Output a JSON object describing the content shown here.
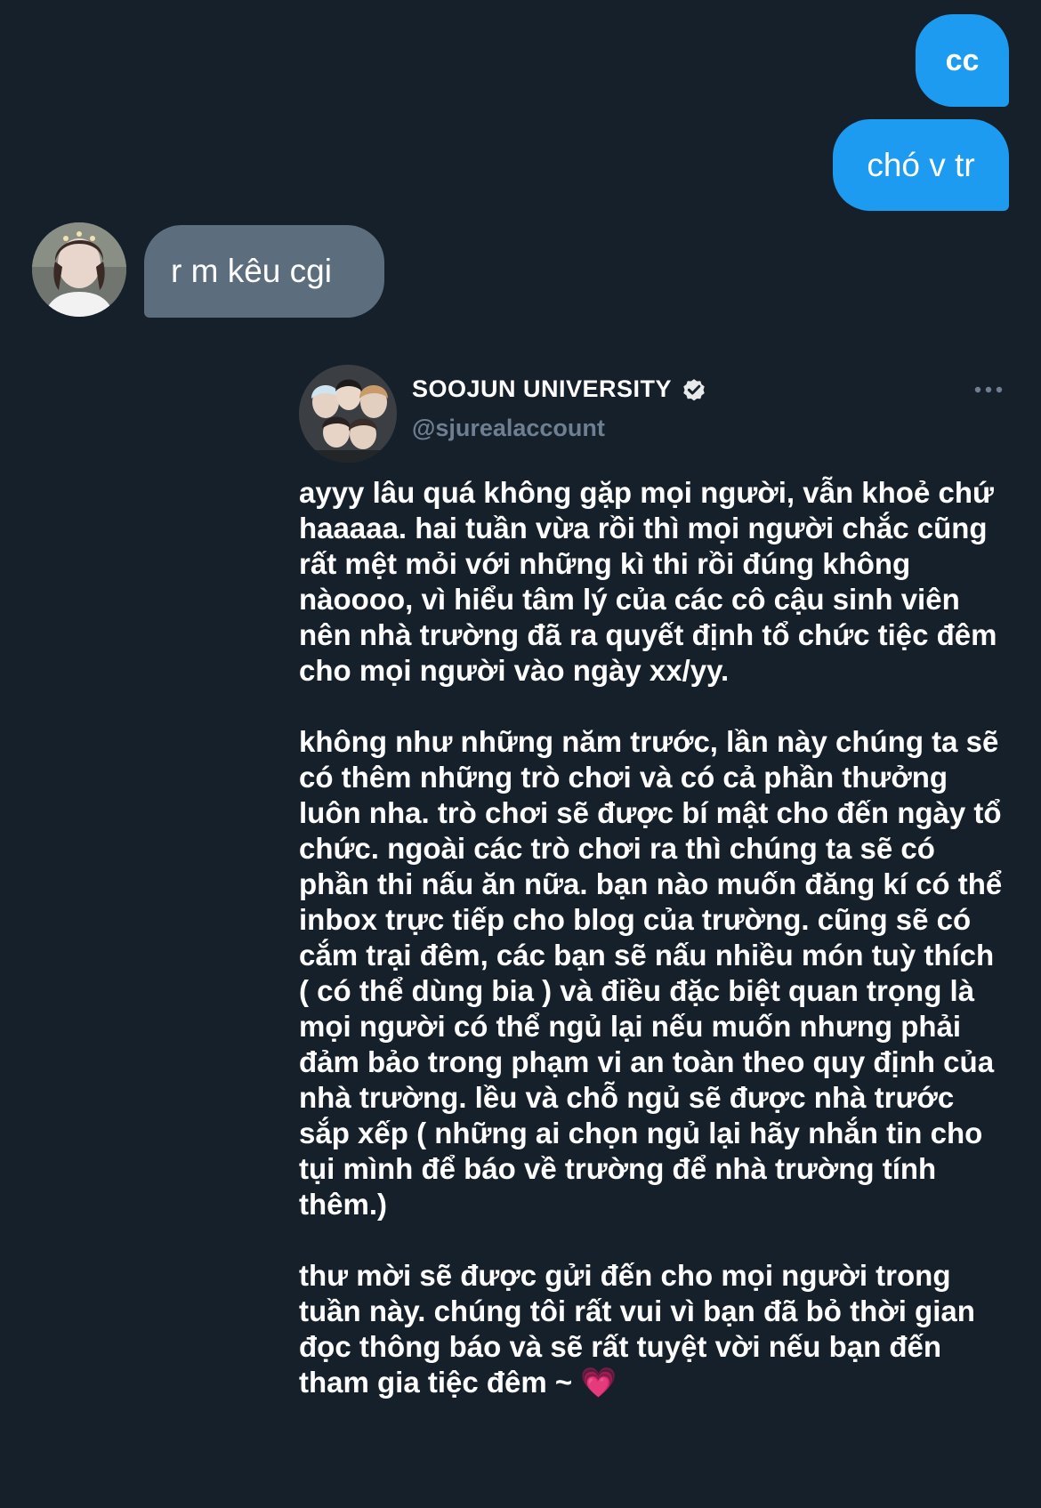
{
  "messages": [
    {
      "id": "cc",
      "direction": "outgoing",
      "text": "cc"
    },
    {
      "id": "chovtr",
      "direction": "outgoing",
      "text": "chó v tr"
    },
    {
      "id": "rm",
      "direction": "incoming",
      "text": "r m kêu cgi"
    }
  ],
  "tweet": {
    "name": "SOOJUN UNIVERSITY",
    "handle": "@sjurealaccount",
    "verified": true,
    "paragraphs": [
      "ayyy lâu quá không gặp mọi người, vẫn khoẻ chứ haaaaa. hai tuần vừa rồi thì mọi người chắc cũng rất mệt mỏi với những kì thi rồi đúng không nàoooo, vì hiểu tâm lý của các cô cậu sinh viên nên nhà trường đã ra quyết định tổ chức tiệc đêm cho mọi người vào ngày xx/yy.",
      "không như những năm trước, lần này chúng ta sẽ có thêm những trò chơi và có cả phần thưởng luôn nha. trò chơi sẽ được bí mật cho đến ngày tổ chức. ngoài các trò chơi ra thì chúng ta sẽ có phần thi nấu ăn nữa. bạn nào muốn đăng kí có thể inbox trực tiếp cho blog của trường. cũng sẽ có cắm trại đêm, các bạn sẽ nấu nhiều món tuỳ thích ( có thể dùng bia ) và điều đặc biệt quan trọng là mọi người có thể ngủ lại nếu muốn nhưng phải đảm bảo trong phạm vi an toàn theo quy định của nhà trường. lều và chỗ ngủ sẽ được nhà trước sắp xếp ( những ai chọn ngủ lại hãy nhắn tin cho tụi mình để báo về trường để nhà trường tính thêm.)",
      "thư mời sẽ được gửi đến cho mọi người trong tuần này. chúng tôi rất vui vì bạn đã bỏ thời gian đọc thông báo và sẽ rất tuyệt vời nếu bạn đến tham gia tiệc đêm ~"
    ],
    "end_emoji": "💗"
  },
  "icons": {
    "verified": "verified-badge-icon",
    "more": "more-options-icon"
  },
  "colors": {
    "background": "#15202b",
    "outgoing_bubble": "#1d9bf0",
    "incoming_bubble": "#5c6d7e",
    "handle_text": "#6e7f91"
  }
}
